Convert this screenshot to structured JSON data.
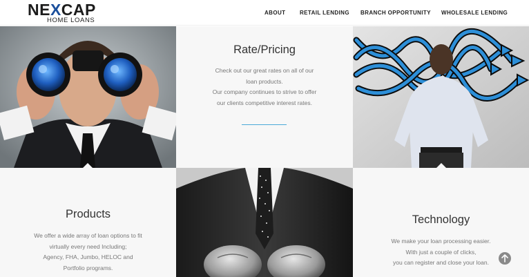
{
  "logo": {
    "main_pre": "NE",
    "main_x": "X",
    "main_post": "CAP",
    "sub": "HOME LOANS"
  },
  "nav": {
    "about": "ABOUT",
    "retail_lending": "RETAIL LENDING",
    "branch_opportunity": "BRANCH OPPORTUNITY",
    "wholesale_lending": "WHOLESALE LENDING"
  },
  "rate_pricing": {
    "title": "Rate/Pricing",
    "lines": [
      "Check out our great rates on all of our",
      "loan products.",
      "Our company continues to strive to offer",
      "our clients competitive interest rates."
    ]
  },
  "products": {
    "title": "Products",
    "lines": [
      "We offer a wide array of loan options to fit",
      "virtually every need Including;",
      "Agency, FHA, Jumbo, HELOC and",
      "Portfolio programs."
    ]
  },
  "technology": {
    "title": "Technology",
    "lines": [
      "We make your loan processing easier.",
      "With just a couple of clicks,",
      "you can register and close your loan."
    ]
  },
  "images": {
    "binoculars": "man-with-binoculars-image",
    "arrows": "man-facing-arrows-image",
    "boxer": "suited-man-boxing-gloves-image"
  },
  "colors": {
    "brand_blue": "#1b4f9c",
    "accent_line": "#4aa8d8",
    "arrow_blue": "#2d8fd8"
  }
}
